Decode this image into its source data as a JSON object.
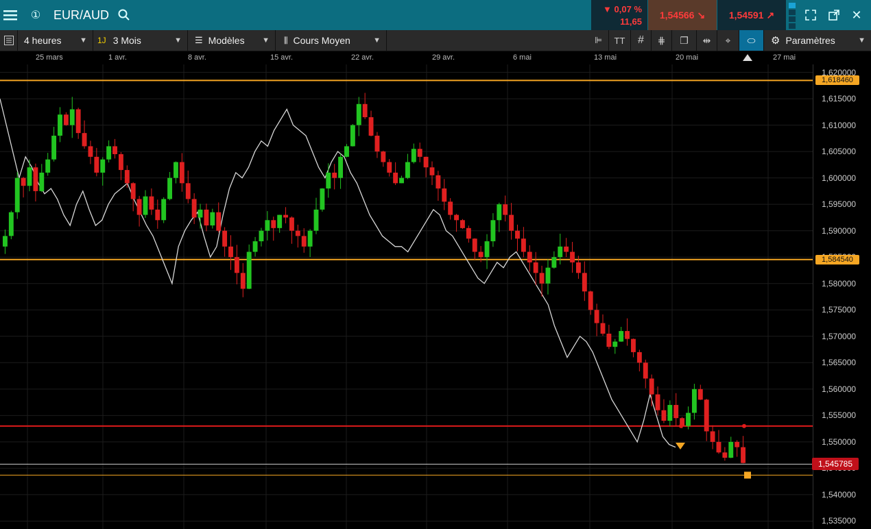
{
  "topbar": {
    "symbol": "EUR/AUD",
    "indicator": "①",
    "change_pct": "▼ 0,07 %",
    "change_abs": "11,65",
    "sell": "1,54566",
    "buy": "1,54591",
    "icons": [
      "menu-icon",
      "search-icon",
      "expand-icon",
      "popout-icon",
      "close-icon"
    ]
  },
  "toolbar": {
    "interval": "4 heures",
    "period_badge": "1J",
    "period": "3 Mois",
    "templates": "Modèles",
    "chart_type": "Cours Moyen",
    "settings": "Paramètres"
  },
  "colors": {
    "up": "#22c521",
    "down": "#e02020",
    "level": "#f5a623",
    "red_line": "#e21b1b",
    "compare": "#d8d8d8"
  },
  "chart_data": {
    "type": "candlestick",
    "x_tick_labels": [
      "25 mars",
      "1 avr.",
      "8 avr.",
      "15 avr.",
      "22 avr.",
      "29 avr.",
      "6 mai",
      "13 mai",
      "20 mai",
      "27 mai"
    ],
    "y_ticks": [
      "1,620000",
      "1,615000",
      "1,610000",
      "1,605000",
      "1,600000",
      "1,595000",
      "1,590000",
      "1,585000",
      "1,580000",
      "1,575000",
      "1,570000",
      "1,565000",
      "1,560000",
      "1,555000",
      "1,550000",
      "1,545000",
      "1,540000",
      "1,535000"
    ],
    "ylim": [
      1.5335,
      1.6215
    ],
    "horizontal_lines": [
      {
        "label": "1,618460",
        "value": 1.61846,
        "color": "#f5a623"
      },
      {
        "label": "1,584540",
        "value": 1.58454,
        "color": "#f5a623"
      },
      {
        "value": 1.553,
        "color": "#e21b1b"
      },
      {
        "value": 1.5437,
        "color": "#f5a623"
      }
    ],
    "current_price": "1,545785",
    "current_value": 1.545785,
    "closes": [
      1.589,
      1.5935,
      1.6,
      1.5985,
      1.602,
      1.5975,
      1.601,
      1.6035,
      1.608,
      1.612,
      1.61,
      1.613,
      1.6085,
      1.606,
      1.604,
      1.601,
      1.6035,
      1.606,
      1.6045,
      1.6015,
      1.599,
      1.596,
      1.593,
      1.5965,
      1.594,
      1.592,
      1.596,
      1.6,
      1.603,
      1.599,
      1.596,
      1.5925,
      1.594,
      1.591,
      1.5935,
      1.59,
      1.587,
      1.585,
      1.582,
      1.579,
      1.586,
      1.588,
      1.59,
      1.592,
      1.5905,
      1.593,
      1.5925,
      1.59,
      1.589,
      1.587,
      1.59,
      1.594,
      1.598,
      1.601,
      1.6,
      1.604,
      1.606,
      1.61,
      1.614,
      1.6115,
      1.608,
      1.605,
      1.603,
      1.601,
      1.599,
      1.6,
      1.603,
      1.6055,
      1.604,
      1.602,
      1.6005,
      1.598,
      1.5955,
      1.593,
      1.592,
      1.5905,
      1.5885,
      1.586,
      1.585,
      1.588,
      1.592,
      1.595,
      1.593,
      1.59,
      1.5885,
      1.586,
      1.584,
      1.582,
      1.58,
      1.583,
      1.585,
      1.587,
      1.586,
      1.584,
      1.582,
      1.5785,
      1.575,
      1.5725,
      1.5705,
      1.568,
      1.569,
      1.571,
      1.5695,
      1.567,
      1.565,
      1.562,
      1.559,
      1.556,
      1.554,
      1.557,
      1.5545,
      1.553,
      1.5555,
      1.56,
      1.558,
      1.552,
      1.55,
      1.548,
      1.547,
      1.55,
      1.549,
      1.546
    ],
    "compare_series": [
      1.615,
      1.61,
      1.605,
      1.6,
      1.604,
      1.602,
      1.599,
      1.597,
      1.598,
      1.596,
      1.593,
      1.591,
      1.595,
      1.5975,
      1.594,
      1.591,
      1.592,
      1.595,
      1.597,
      1.598,
      1.599,
      1.596,
      1.5935,
      1.591,
      1.589,
      1.586,
      1.583,
      1.58,
      1.587,
      1.59,
      1.592,
      1.5935,
      1.589,
      1.585,
      1.587,
      1.593,
      1.598,
      1.601,
      1.6,
      1.602,
      1.605,
      1.607,
      1.606,
      1.609,
      1.611,
      1.613,
      1.61,
      1.609,
      1.608,
      1.605,
      1.602,
      1.6,
      1.603,
      1.605,
      1.604,
      1.601,
      1.599,
      1.596,
      1.593,
      1.591,
      1.589,
      1.588,
      1.587,
      1.587,
      1.586,
      1.588,
      1.59,
      1.592,
      1.594,
      1.593,
      1.59,
      1.589,
      1.587,
      1.585,
      1.583,
      1.581,
      1.58,
      1.582,
      1.584,
      1.583,
      1.585,
      1.586,
      1.584,
      1.582,
      1.58,
      1.578,
      1.576,
      1.572,
      1.569,
      1.566,
      1.568,
      1.57,
      1.569,
      1.567,
      1.564,
      1.561,
      1.558,
      1.556,
      1.554,
      1.552,
      1.55,
      1.554,
      1.559,
      1.555,
      1.551,
      1.5495,
      1.549
    ]
  }
}
